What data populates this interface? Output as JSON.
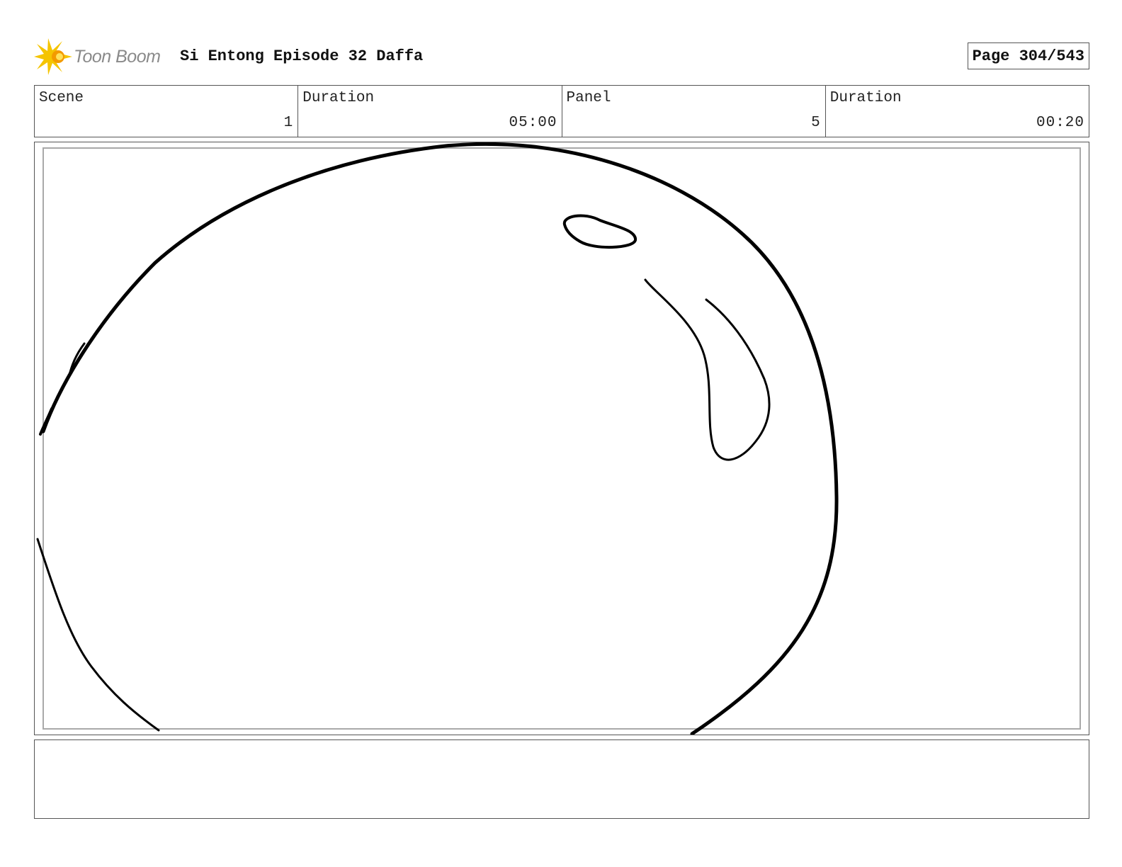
{
  "header": {
    "logo_text": "Toon Boom",
    "logo_icon": "toon-boom-starburst-icon",
    "project_title": "Si Entong Episode 32 Daffa",
    "page_indicator": "Page 304/543"
  },
  "info_table": {
    "scene_label": "Scene",
    "scene_value": "1",
    "scene_duration_label": "Duration",
    "scene_duration_value": "05:00",
    "panel_label": "Panel",
    "panel_value": "5",
    "panel_duration_label": "Duration",
    "panel_duration_value": "00:20"
  },
  "panel": {
    "drawing": "sketch-bubble-with-highlights"
  },
  "notes": {
    "text": ""
  },
  "colors": {
    "logo_yellow": "#f5c400",
    "logo_orange": "#f39a00",
    "logo_text": "#8a8a8a",
    "border": "#555555",
    "safe_frame": "#a9a9a9",
    "ink": "#000000"
  }
}
